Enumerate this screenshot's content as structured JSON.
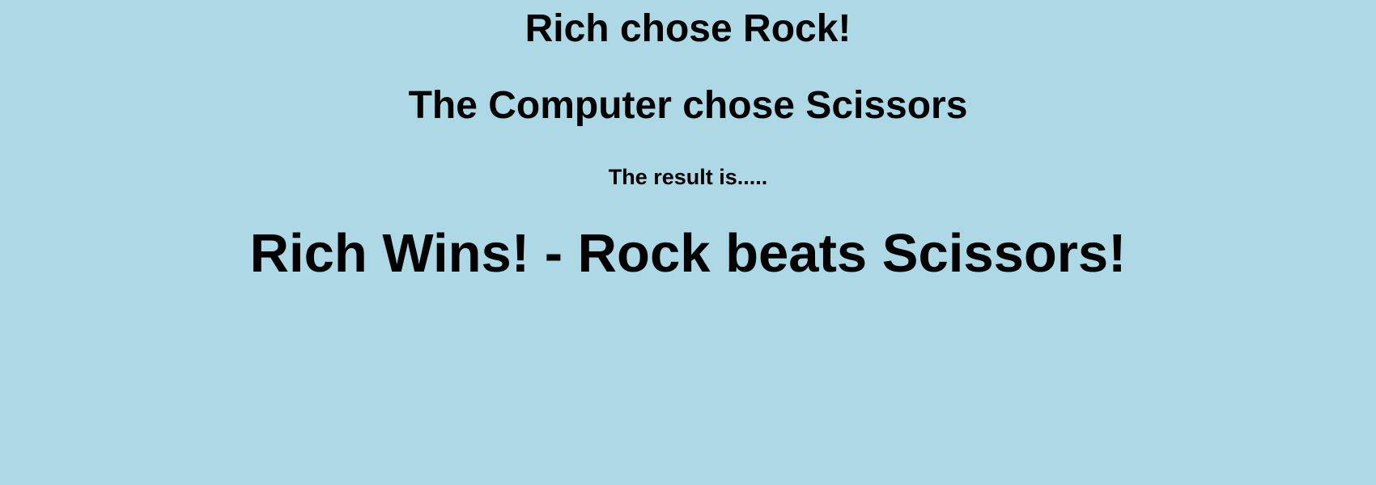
{
  "game": {
    "player_choice_text": "Rich chose Rock!",
    "computer_choice_text": "The Computer chose Scissors",
    "result_intro_text": "The result is.....",
    "result_headline_text": "Rich Wins! - Rock beats Scissors!"
  },
  "colors": {
    "background": "#add8e6",
    "text": "#000000"
  }
}
